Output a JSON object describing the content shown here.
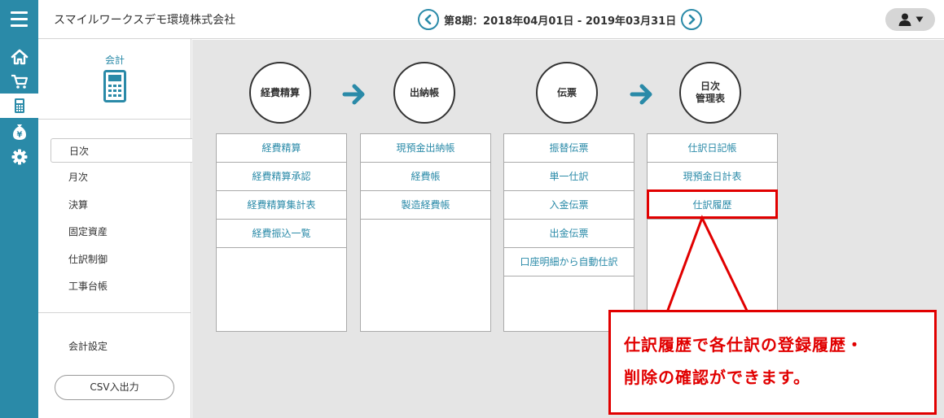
{
  "header": {
    "company_name": "スマイルワークスデモ環境株式会社",
    "period_label": "第8期：2018年04月01日 - 2019年03月31日",
    "prev_glyph": "<",
    "next_glyph": ">",
    "accent_color": "#2a8aa8"
  },
  "rail": {
    "items": [
      {
        "icon": "home-icon"
      },
      {
        "icon": "cart-icon"
      },
      {
        "icon": "calculator-icon",
        "active": true
      },
      {
        "icon": "money-bag-icon"
      },
      {
        "icon": "gear-icon"
      }
    ]
  },
  "submenu": {
    "title": "会計",
    "items": [
      {
        "label": "日次",
        "active": true
      },
      {
        "label": "月次"
      },
      {
        "label": "決算"
      },
      {
        "label": "固定資産"
      },
      {
        "label": "仕訳制御"
      },
      {
        "label": "工事台帳"
      }
    ],
    "settings_label": "会計設定",
    "csv_button_label": "CSV入出力"
  },
  "flow": {
    "steps": [
      {
        "label": "経費精算"
      },
      {
        "label": "出納帳"
      },
      {
        "label": "伝票"
      },
      {
        "label": "日次\n管理表"
      }
    ]
  },
  "panels": [
    {
      "items": [
        "経費精算",
        "経費精算承認",
        "経費精算集計表",
        "経費振込一覧"
      ]
    },
    {
      "items": [
        "現預金出納帳",
        "経費帳",
        "製造経費帳"
      ]
    },
    {
      "items": [
        "振替伝票",
        "単一仕訳",
        "入金伝票",
        "出金伝票",
        "口座明細から自動仕訳"
      ]
    },
    {
      "items": [
        "仕訳日記帳",
        "現預金日計表",
        "仕訳履歴"
      ]
    }
  ],
  "callout": {
    "line1": "仕訳履歴で各仕訳の登録履歴・",
    "line2": "削除の確認ができます。",
    "color": "#e10000"
  }
}
